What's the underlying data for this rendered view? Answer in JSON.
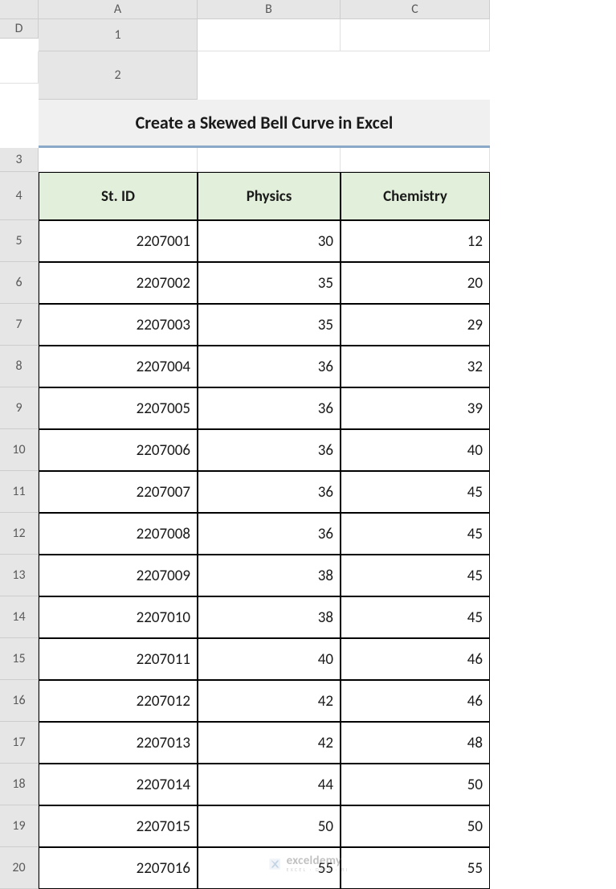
{
  "columns": [
    "A",
    "B",
    "C",
    "D"
  ],
  "row_numbers": [
    1,
    2,
    3,
    4,
    5,
    6,
    7,
    8,
    9,
    10,
    11,
    12,
    13,
    14,
    15,
    16,
    17,
    18,
    19,
    20
  ],
  "title": "Create a Skewed Bell Curve in Excel",
  "headers": {
    "id": "St. ID",
    "physics": "Physics",
    "chemistry": "Chemistry"
  },
  "rows": [
    {
      "id": "2207001",
      "physics": "30",
      "chemistry": "12"
    },
    {
      "id": "2207002",
      "physics": "35",
      "chemistry": "20"
    },
    {
      "id": "2207003",
      "physics": "35",
      "chemistry": "29"
    },
    {
      "id": "2207004",
      "physics": "36",
      "chemistry": "32"
    },
    {
      "id": "2207005",
      "physics": "36",
      "chemistry": "39"
    },
    {
      "id": "2207006",
      "physics": "36",
      "chemistry": "40"
    },
    {
      "id": "2207007",
      "physics": "36",
      "chemistry": "45"
    },
    {
      "id": "2207008",
      "physics": "36",
      "chemistry": "45"
    },
    {
      "id": "2207009",
      "physics": "38",
      "chemistry": "45"
    },
    {
      "id": "2207010",
      "physics": "38",
      "chemistry": "45"
    },
    {
      "id": "2207011",
      "physics": "40",
      "chemistry": "46"
    },
    {
      "id": "2207012",
      "physics": "42",
      "chemistry": "46"
    },
    {
      "id": "2207013",
      "physics": "42",
      "chemistry": "48"
    },
    {
      "id": "2207014",
      "physics": "44",
      "chemistry": "50"
    },
    {
      "id": "2207015",
      "physics": "50",
      "chemistry": "50"
    },
    {
      "id": "2207016",
      "physics": "55",
      "chemistry": "55"
    }
  ],
  "watermark": {
    "main": "exceldemy",
    "sub": "EXCEL · DATA · BI"
  }
}
